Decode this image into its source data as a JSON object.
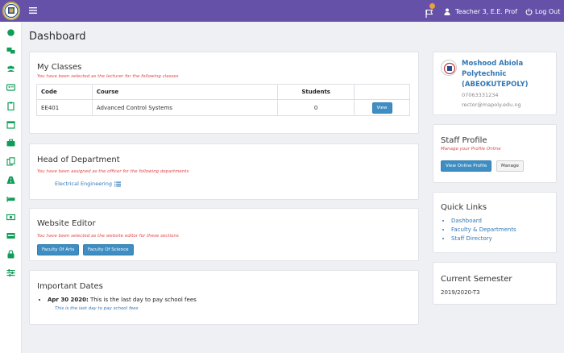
{
  "topbar": {
    "user_name": "Teacher 3, E.E. Prof",
    "logout_label": "Log Out",
    "accent_color": "#6552a8"
  },
  "page_title": "Dashboard",
  "my_classes": {
    "title": "My Classes",
    "subtitle": "You have been selected as the lecturer for the following classes",
    "columns": [
      "Code",
      "Course",
      "Students",
      ""
    ],
    "rows": [
      {
        "code": "EE401",
        "course": "Advanced Control Systems",
        "students": "0",
        "action": "View"
      }
    ]
  },
  "hod": {
    "title": "Head of Department",
    "subtitle": "You have been assigned as the officer for the following departments",
    "department": "Electrical Engineering"
  },
  "website_editor": {
    "title": "Website Editor",
    "subtitle": "You have been selected as the website editor for these sections",
    "sections": [
      "Faculty Of Arts",
      "Faculty Of Science"
    ]
  },
  "important_dates": {
    "title": "Important Dates",
    "items": [
      {
        "date": "Apr 30 2020:",
        "text": "This is the last day to pay school fees",
        "note": "This is the last day to pay school fees"
      }
    ]
  },
  "institution": {
    "name_line1": "Moshood Abiola",
    "name_line2": "Polytechnic",
    "name_line3": "(ABEOKUTEPOLY)",
    "phone": "07063331234",
    "email": "rector@mapoly.edu.ng"
  },
  "staff_profile": {
    "title": "Staff Profile",
    "subtitle": "Manage your Profile Online",
    "view_label": "View Online Profile",
    "manage_label": "Manage"
  },
  "quick_links": {
    "title": "Quick Links",
    "items": [
      "Dashboard",
      "Faculty & Departments",
      "Staff Directory"
    ]
  },
  "current_semester": {
    "title": "Current Semester",
    "value": "2019/2020-T3"
  },
  "sidebar_icons": [
    "dashboard-icon",
    "classes-icon",
    "users-icon",
    "id-card-icon",
    "clipboard-icon",
    "calendar-icon",
    "briefcase-icon",
    "documents-icon",
    "road-icon",
    "bed-icon",
    "money-icon",
    "pdf-icon",
    "lock-icon",
    "sliders-icon"
  ]
}
